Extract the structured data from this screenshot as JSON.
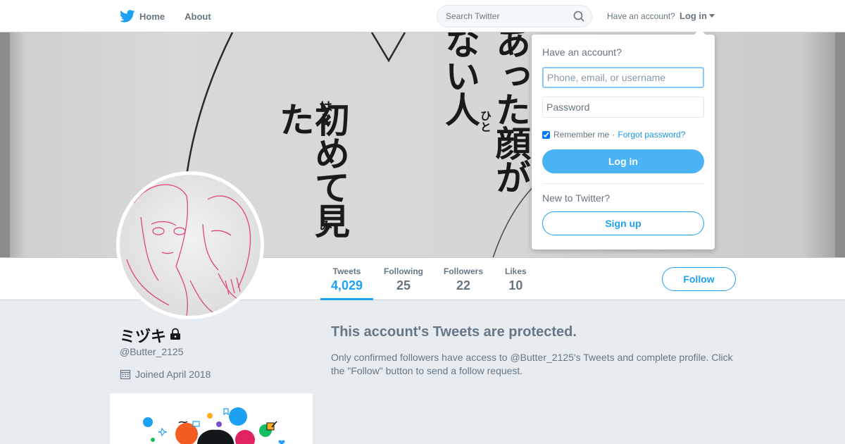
{
  "nav": {
    "logo_icon": "twitter-bird-icon",
    "home_label": "Home",
    "about_label": "About",
    "search_placeholder": "Search Twitter",
    "have_account": "Have an account?",
    "login_label": "Log in"
  },
  "banner": {
    "columns": [
      "初めて見た",
      "はじ",
      "み",
      "あった顔が",
      "ない人",
      "ひと"
    ]
  },
  "profile": {
    "display_name": "ミヅキ",
    "handle": "@Butter_2125",
    "joined": "Joined April 2018",
    "protected": true
  },
  "stats": [
    {
      "label": "Tweets",
      "value": "4,029"
    },
    {
      "label": "Following",
      "value": "25"
    },
    {
      "label": "Followers",
      "value": "22"
    },
    {
      "label": "Likes",
      "value": "10"
    }
  ],
  "follow_label": "Follow",
  "protected_notice": {
    "title": "This account's Tweets are protected.",
    "body": "Only confirmed followers have access to @Butter_2125's Tweets and complete profile. Click the \"Follow\" button to send a follow request."
  },
  "login_dropdown": {
    "title": "Have an account?",
    "username_placeholder": "Phone, email, or username",
    "password_placeholder": "Password",
    "remember_me": "Remember me",
    "separator": "·",
    "forgot_password": "Forgot password?",
    "login_button": "Log in",
    "new_to_twitter": "New to Twitter?",
    "signup_button": "Sign up"
  },
  "colors": {
    "accent": "#1da1f2",
    "muted": "#657786",
    "page_bg": "#e6ecf0"
  }
}
